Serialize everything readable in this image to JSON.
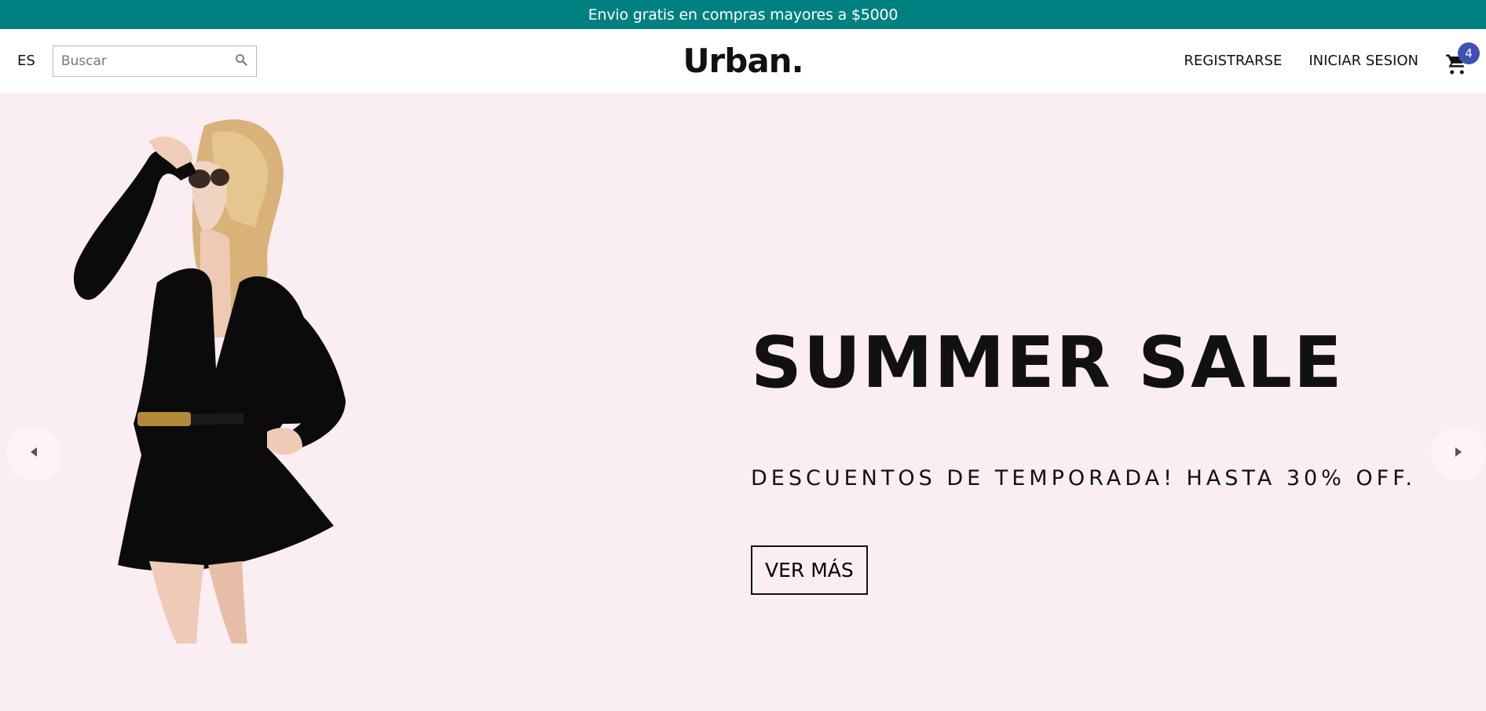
{
  "announcement": {
    "text": "Envio gratis en compras mayores a $5000"
  },
  "header": {
    "language": "ES",
    "search": {
      "placeholder": "Buscar",
      "value": ""
    },
    "logo": "Urban.",
    "register_label": "REGISTRARSE",
    "login_label": "INICIAR SESION",
    "cart_count": "4"
  },
  "slide": {
    "title": "SUMMER SALE",
    "description": "DESCUENTOS DE TEMPORADA! HASTA 30% OFF.",
    "button_label": "VER MÁS"
  },
  "colors": {
    "announcement_bg": "#008080",
    "slide_bg": "#fbeef2",
    "badge_bg": "#3f51b5"
  },
  "icons": [
    "search-icon",
    "cart-icon",
    "arrow-left-icon",
    "arrow-right-icon"
  ]
}
